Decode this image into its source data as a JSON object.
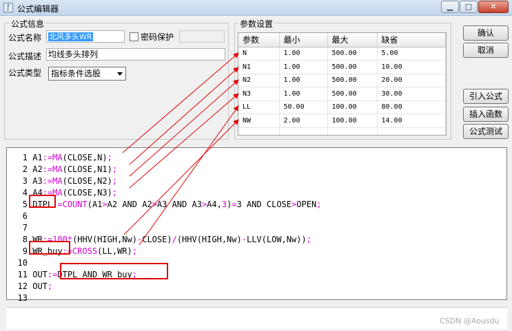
{
  "window": {
    "title": "公式编辑器",
    "icon": "formula-app-icon",
    "controls": [
      "minimize-icon",
      "maximize-icon",
      "close-icon"
    ]
  },
  "info": {
    "group_title": "公式信息",
    "name_label": "公式名称",
    "name_value": "北风多头WR",
    "password_label": "密码保护",
    "password_checked": false,
    "desc_label": "公式描述",
    "desc_value": "均线多头排列",
    "type_label": "公式类型",
    "type_value": "指标条件选股"
  },
  "params": {
    "group_title": "参数设置",
    "headers": [
      "参数",
      "最小",
      "最大",
      "缺省"
    ],
    "rows": [
      [
        "N",
        "1.00",
        "500.00",
        "5.00"
      ],
      [
        "N1",
        "1.00",
        "500.00",
        "10.00"
      ],
      [
        "N2",
        "1.00",
        "500.00",
        "20.00"
      ],
      [
        "N3",
        "1.00",
        "500.00",
        "30.00"
      ],
      [
        "LL",
        "50.00",
        "100.00",
        "80.00"
      ],
      [
        "NW",
        "2.00",
        "100.00",
        "14.00"
      ],
      [
        "",
        "",
        "",
        ""
      ]
    ]
  },
  "buttons": {
    "ok": "确认",
    "cancel": "取消",
    "import": "引入公式",
    "insert_func": "插入函数",
    "test": "公式测试"
  },
  "editor": {
    "lines": [
      {
        "n": "1",
        "parts": [
          [
            "A1",
            "c"
          ],
          [
            ":=",
            "o"
          ],
          [
            "MA",
            "o"
          ],
          [
            "(CLOSE,N)",
            "c"
          ],
          [
            ";",
            "o"
          ]
        ]
      },
      {
        "n": "2",
        "parts": [
          [
            "A2",
            "c"
          ],
          [
            ":=",
            "o"
          ],
          [
            "MA",
            "o"
          ],
          [
            "(CLOSE,N1)",
            "c"
          ],
          [
            ";",
            "o"
          ]
        ]
      },
      {
        "n": "3",
        "parts": [
          [
            "A3",
            "c"
          ],
          [
            ":=",
            "o"
          ],
          [
            "MA",
            "o"
          ],
          [
            "(CLOSE,N2)",
            "c"
          ],
          [
            ";",
            "o"
          ]
        ]
      },
      {
        "n": "4",
        "parts": [
          [
            "A4",
            "c"
          ],
          [
            ":=",
            "o"
          ],
          [
            "MA",
            "o"
          ],
          [
            "(CLOSE,N3)",
            "c"
          ],
          [
            ";",
            "o"
          ]
        ]
      },
      {
        "n": "5",
        "parts": [
          [
            "DTPL",
            "c"
          ],
          [
            ":=",
            "o"
          ],
          [
            "COUNT",
            "o"
          ],
          [
            "(A1",
            "c"
          ],
          [
            ">",
            "o"
          ],
          [
            "A2 AND A2",
            "c"
          ],
          [
            ">",
            "o"
          ],
          [
            "A3 AND A3",
            "c"
          ],
          [
            ">",
            "o"
          ],
          [
            "A4,",
            "c"
          ],
          [
            "3",
            "o"
          ],
          [
            ")",
            "c"
          ],
          [
            "=",
            "o"
          ],
          [
            "3 AND CLOSE",
            "c"
          ],
          [
            ">",
            "o"
          ],
          [
            "OPEN",
            "c"
          ],
          [
            ";",
            "o"
          ]
        ]
      },
      {
        "n": "6",
        "parts": []
      },
      {
        "n": "7",
        "parts": []
      },
      {
        "n": "8",
        "parts": [
          [
            "WR",
            "c"
          ],
          [
            ":=",
            "o"
          ],
          [
            "100",
            "o"
          ],
          [
            "*",
            "o"
          ],
          [
            "(HHV(HIGH,Nw)",
            "c"
          ],
          [
            "-",
            "o"
          ],
          [
            "CLOSE)",
            "c"
          ],
          [
            "/",
            "o"
          ],
          [
            "(HHV(HIGH,Nw)",
            "c"
          ],
          [
            "-",
            "o"
          ],
          [
            "LLV(LOW,Nw))",
            "c"
          ],
          [
            ";",
            "o"
          ]
        ]
      },
      {
        "n": "9",
        "parts": [
          [
            "WR_buy",
            "c"
          ],
          [
            ":=",
            "o"
          ],
          [
            "CROSS",
            "o"
          ],
          [
            "(LL,WR)",
            "c"
          ],
          [
            ";",
            "o"
          ]
        ]
      },
      {
        "n": "10",
        "parts": []
      },
      {
        "n": "11",
        "parts": [
          [
            "OUT",
            "c"
          ],
          [
            ":=",
            "o"
          ],
          [
            "DTPL AND WR_buy",
            "c"
          ],
          [
            ";",
            "o"
          ]
        ]
      },
      {
        "n": "12",
        "parts": [
          [
            "OUT",
            "c"
          ],
          [
            ";",
            "o"
          ]
        ]
      },
      {
        "n": "13",
        "parts": []
      }
    ]
  },
  "annotation_color": "#e00000",
  "watermark": "CSDN @Aousdu"
}
